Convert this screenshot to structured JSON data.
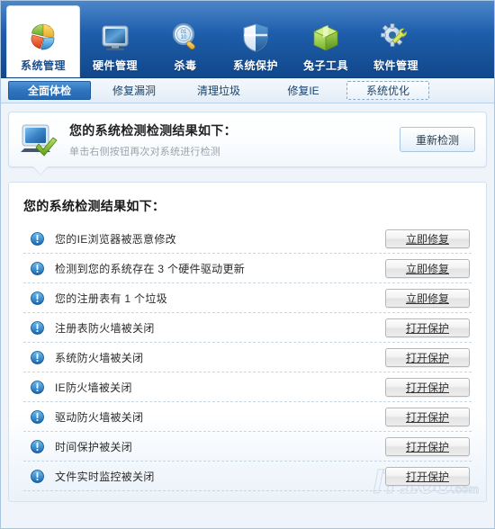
{
  "nav": {
    "items": [
      {
        "label": "系统管理",
        "icon": "pie-chart-icon",
        "active": true
      },
      {
        "label": "硬件管理",
        "icon": "monitor-icon",
        "active": false
      },
      {
        "label": "杀毒",
        "icon": "magnifier-icon",
        "active": false
      },
      {
        "label": "系统保护",
        "icon": "shield-icon",
        "active": false
      },
      {
        "label": "兔子工具",
        "icon": "green-box-icon",
        "active": false
      },
      {
        "label": "软件管理",
        "icon": "gear-wrench-icon",
        "active": false
      }
    ]
  },
  "tabs": [
    {
      "label": "全面体检",
      "state": "selected"
    },
    {
      "label": "修复漏洞",
      "state": "normal"
    },
    {
      "label": "清理垃圾",
      "state": "normal"
    },
    {
      "label": "修复IE",
      "state": "normal"
    },
    {
      "label": "系统优化",
      "state": "focused"
    }
  ],
  "banner": {
    "icon": "monitor-check-icon",
    "title": "您的系统检测检测结果如下：",
    "subtitle": "单击右侧按钮再次对系统进行检测",
    "rescan_label": "重新检测"
  },
  "panel": {
    "title": "您的系统检测结果如下：",
    "rows": [
      {
        "icon": "warning-info-icon",
        "text": "您的IE浏览器被恶意修改",
        "action": "立即修复"
      },
      {
        "icon": "warning-info-icon",
        "text": "检测到您的系统存在 3 个硬件驱动更新",
        "action": "立即修复"
      },
      {
        "icon": "warning-info-icon",
        "text": "您的注册表有 1 个垃圾",
        "action": "立即修复"
      },
      {
        "icon": "warning-info-icon",
        "text": "注册表防火墙被关闭",
        "action": "打开保护"
      },
      {
        "icon": "warning-info-icon",
        "text": "系统防火墙被关闭",
        "action": "打开保护"
      },
      {
        "icon": "warning-info-icon",
        "text": "IE防火墙被关闭",
        "action": "打开保护"
      },
      {
        "icon": "warning-info-icon",
        "text": "驱动防火墙被关闭",
        "action": "打开保护"
      },
      {
        "icon": "warning-info-icon",
        "text": "时间保护被关闭",
        "action": "打开保护"
      },
      {
        "icon": "warning-info-icon",
        "text": "文件实时监控被关闭",
        "action": "打开保护"
      }
    ]
  },
  "watermark": {
    "text": "IT168",
    "domain": ".com"
  },
  "colors": {
    "nav_blue": "#1f5fae",
    "tab_selected": "#2f74bd",
    "accent_text": "#17456f",
    "warning_icon": "#2f8fe0",
    "panel_bg": "#ffffff"
  }
}
